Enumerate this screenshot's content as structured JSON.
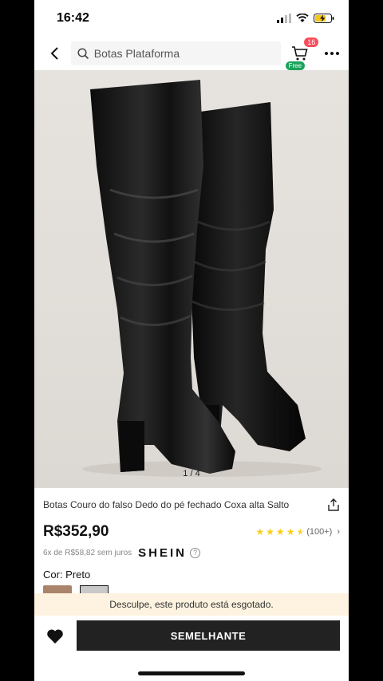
{
  "status": {
    "time": "16:42"
  },
  "search": {
    "placeholder": "Botas Plataforma"
  },
  "cart": {
    "count": "16",
    "free_label": "Free"
  },
  "gallery": {
    "pager": "1 / 4"
  },
  "product": {
    "title": "Botas Couro do falso Dedo do pé fechado Coxa alta Salto",
    "price": "R$352,90",
    "rating_stars": 4.5,
    "review_count": "(100+)",
    "installments": "6x de R$58,82 sem juros",
    "brand": "SHEIN",
    "color_label": "Cor: Preto"
  },
  "notice": {
    "sold_out": "Desculpe, este produto está esgotado."
  },
  "actions": {
    "similar_label": "SEMELHANTE"
  },
  "colors": {
    "price": "#111111",
    "star": "#facf19",
    "badge": "#fa4b5a",
    "free": "#1aa35c",
    "button": "#222222",
    "notice_bg": "#fdf3e0"
  }
}
